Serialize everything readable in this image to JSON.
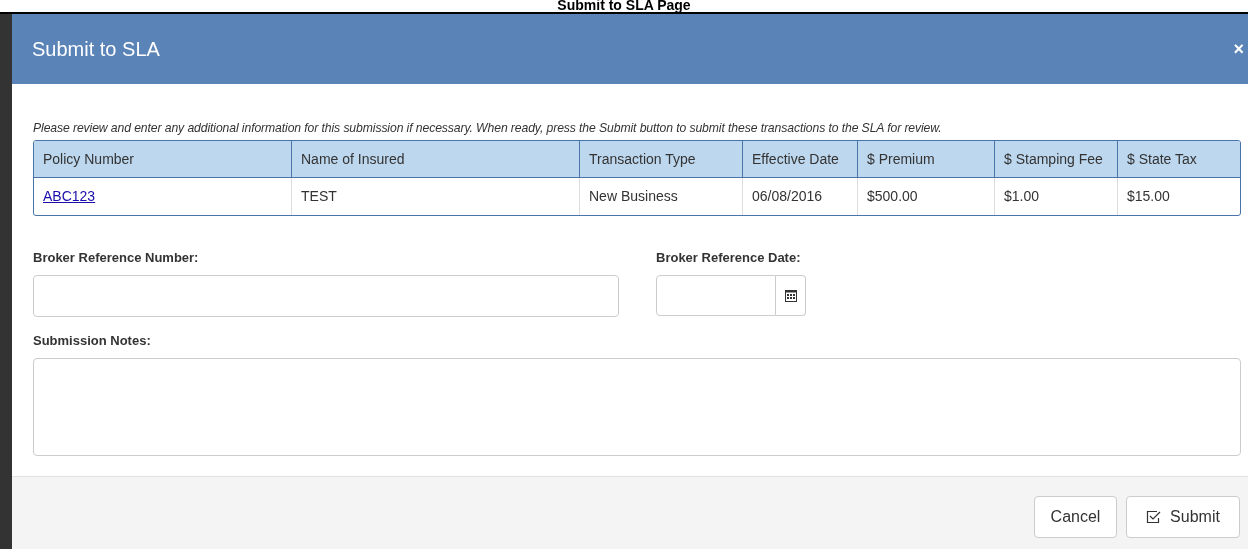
{
  "page_caption": "Submit to SLA Page",
  "dialog": {
    "title": "Submit to SLA",
    "close": "×"
  },
  "instructions": "Please review and enter any additional information for this submission if necessary. When ready, press the Submit button to submit these transactions to the SLA for review.",
  "table": {
    "columns": [
      "Policy Number",
      "Name of Insured",
      "Transaction Type",
      "Effective Date",
      "$ Premium",
      "$ Stamping Fee",
      "$ State Tax"
    ],
    "rows": [
      [
        "ABC123",
        "TEST",
        "New Business",
        "06/08/2016",
        "$500.00",
        "$1.00",
        "$15.00"
      ]
    ]
  },
  "fields": [
    {
      "kind": "text",
      "label": "Broker Reference Number:"
    },
    {
      "kind": "date",
      "label": "Broker Reference Date:"
    },
    {
      "kind": "textarea",
      "label": "Submission Notes:"
    }
  ],
  "buttons": [
    {
      "kind": "cancel",
      "label": "Cancel"
    },
    {
      "kind": "submit",
      "label": "Submit"
    }
  ]
}
